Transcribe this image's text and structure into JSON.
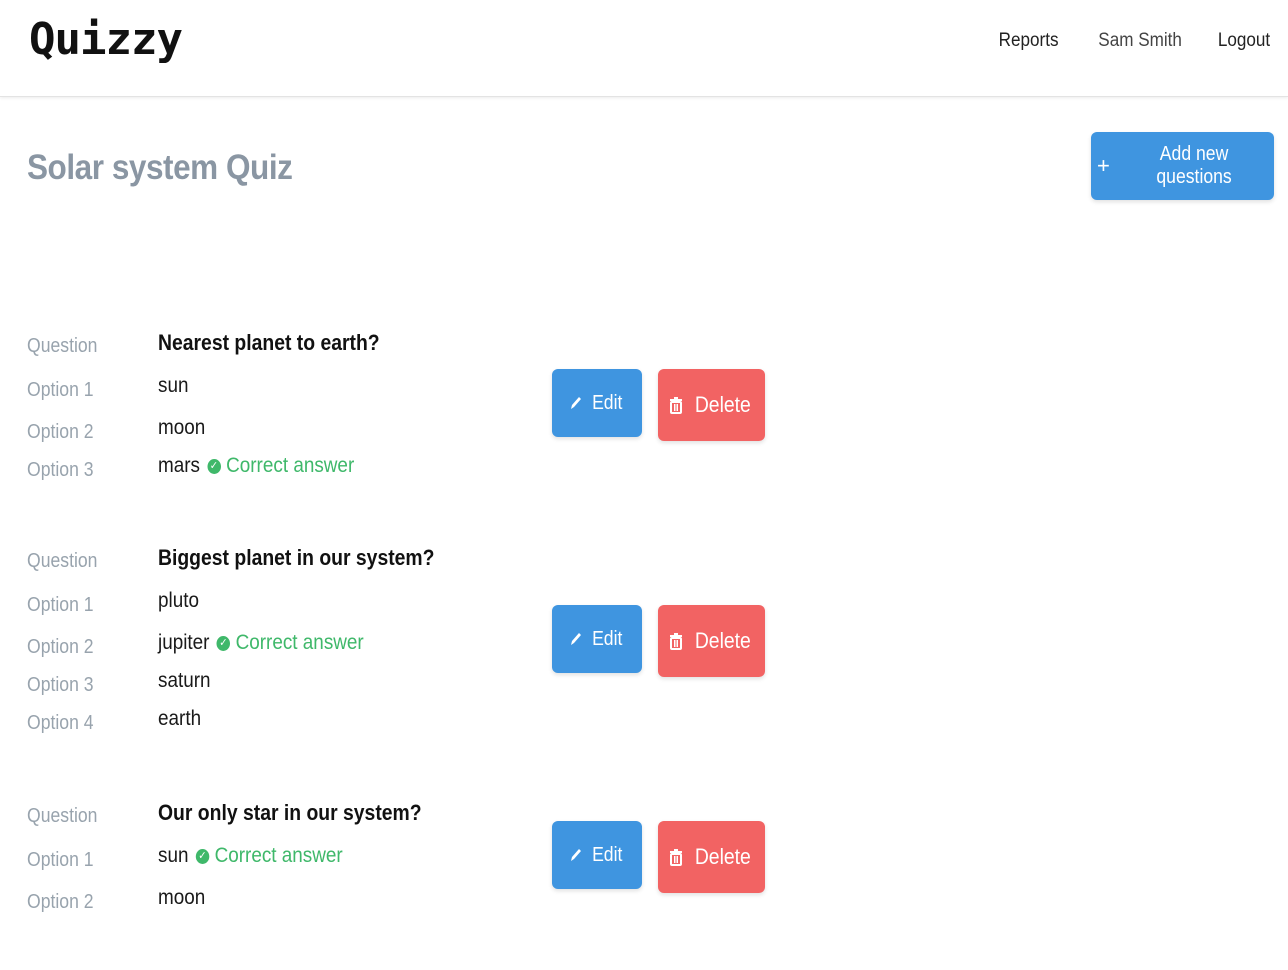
{
  "header": {
    "brand": "Quizzy",
    "nav": [
      "Reports",
      "Sam Smith",
      "Logout"
    ]
  },
  "quiz": {
    "title": "Solar system Quiz",
    "add_button_label": "Add new questions"
  },
  "labels": {
    "question": "Question",
    "option_prefix": "Option",
    "correct": "Correct answer",
    "edit": "Edit",
    "delete": "Delete"
  },
  "questions": [
    {
      "text": "Nearest planet to earth?",
      "options": [
        {
          "label": "Option 1",
          "value": "sun",
          "correct": false
        },
        {
          "label": "Option 2",
          "value": "moon",
          "correct": false
        },
        {
          "label": "Option 3",
          "value": "mars",
          "correct": true
        }
      ]
    },
    {
      "text": "Biggest planet in our system?",
      "options": [
        {
          "label": "Option 1",
          "value": "pluto",
          "correct": false
        },
        {
          "label": "Option 2",
          "value": "jupiter",
          "correct": true
        },
        {
          "label": "Option 3",
          "value": "saturn",
          "correct": false
        },
        {
          "label": "Option 4",
          "value": "earth",
          "correct": false
        }
      ]
    },
    {
      "text": "Our only star in our system?",
      "options": [
        {
          "label": "Option 1",
          "value": "sun",
          "correct": true
        },
        {
          "label": "Option 2",
          "value": "moon",
          "correct": false
        }
      ]
    }
  ],
  "colors": {
    "primary": "#3f95e0",
    "danger": "#f26363",
    "success": "#3fb86a",
    "muted": "#98a3ad"
  }
}
